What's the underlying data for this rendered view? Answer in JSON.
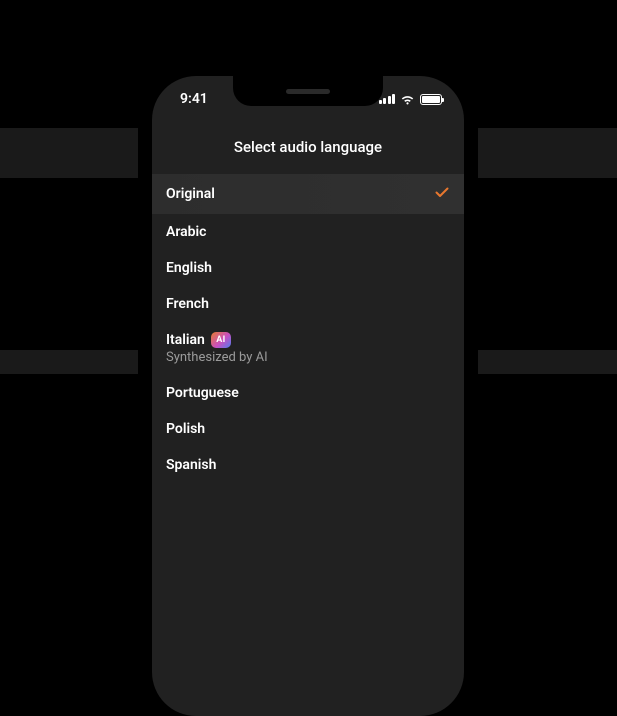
{
  "status": {
    "time": "9:41"
  },
  "header": {
    "title": "Select audio language"
  },
  "ai_badge_text": "AI",
  "languages": [
    {
      "label": "Original",
      "selected": true
    },
    {
      "label": "Arabic"
    },
    {
      "label": "English"
    },
    {
      "label": "French"
    },
    {
      "label": "Italian",
      "ai": true,
      "sub": "Synthesized by AI"
    },
    {
      "label": "Portuguese"
    },
    {
      "label": "Polish"
    },
    {
      "label": "Spanish"
    }
  ]
}
